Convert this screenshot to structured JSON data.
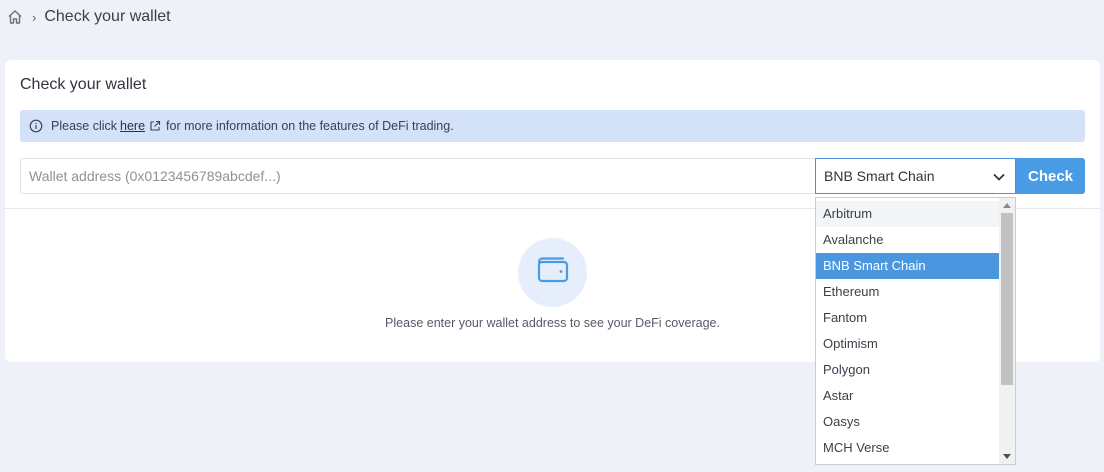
{
  "breadcrumb": {
    "home_icon": "home-icon",
    "separator": "›",
    "current": "Check your wallet"
  },
  "card": {
    "title": "Check your wallet",
    "info": {
      "icon": "info-circle-icon",
      "prefix": "Please click",
      "link_text": "here",
      "link_icon": "external-link-icon",
      "suffix": "for more information on the features of DeFi trading."
    },
    "wallet_input": {
      "placeholder": "Wallet address (0x0123456789abcdef...)",
      "value": ""
    },
    "chain_select": {
      "selected": "BNB Smart Chain",
      "chevron_icon": "chevron-down-icon"
    },
    "check_button": "Check",
    "empty_state": {
      "icon": "wallet-icon",
      "text": "Please enter your wallet address to see your DeFi coverage."
    }
  },
  "dropdown": {
    "options": [
      "Arbitrum",
      "Avalanche",
      "BNB Smart Chain",
      "Ethereum",
      "Fantom",
      "Optimism",
      "Polygon",
      "Astar",
      "Oasys",
      "MCH Verse"
    ],
    "selected_index": 2
  },
  "colors": {
    "accent": "#4a9be6",
    "info_bg": "#d3e1f9",
    "page_bg": "#eef1f8"
  }
}
